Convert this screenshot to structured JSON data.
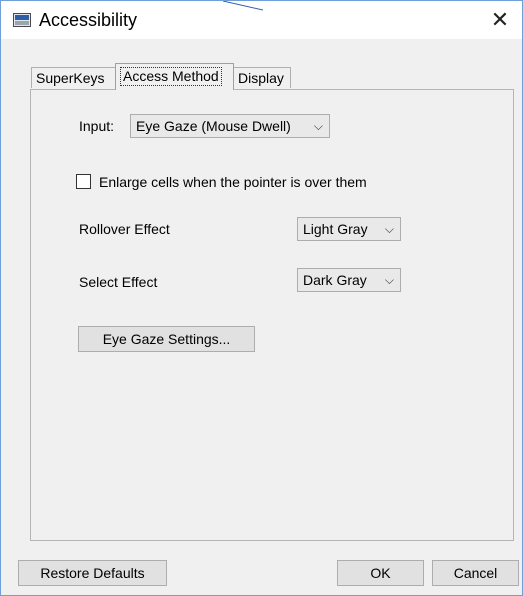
{
  "window": {
    "title": "Accessibility",
    "close_glyph": "✕"
  },
  "tabs": [
    {
      "label": "SuperKeys",
      "selected": false
    },
    {
      "label": "Access Method",
      "selected": true
    },
    {
      "label": "Display",
      "selected": false
    }
  ],
  "access_method": {
    "input_label": "Input:",
    "input_value": "Eye Gaze (Mouse Dwell)",
    "enlarge_label": "Enlarge cells when the pointer is over them",
    "enlarge_checked": false,
    "rollover_label": "Rollover Effect",
    "rollover_value": "Light Gray",
    "select_label": "Select Effect",
    "select_value": "Dark Gray",
    "eye_gaze_button": "Eye Gaze Settings..."
  },
  "footer": {
    "restore_label": "Restore Defaults",
    "ok_label": "OK",
    "cancel_label": "Cancel"
  },
  "icons": {
    "app": "app-icon",
    "close": "close-icon",
    "dropdown": "chevron-down-icon"
  },
  "colors": {
    "window_border": "#6f9fd8",
    "dialog_bg": "#f0f0f0",
    "button_bg": "#e1e1e1"
  }
}
